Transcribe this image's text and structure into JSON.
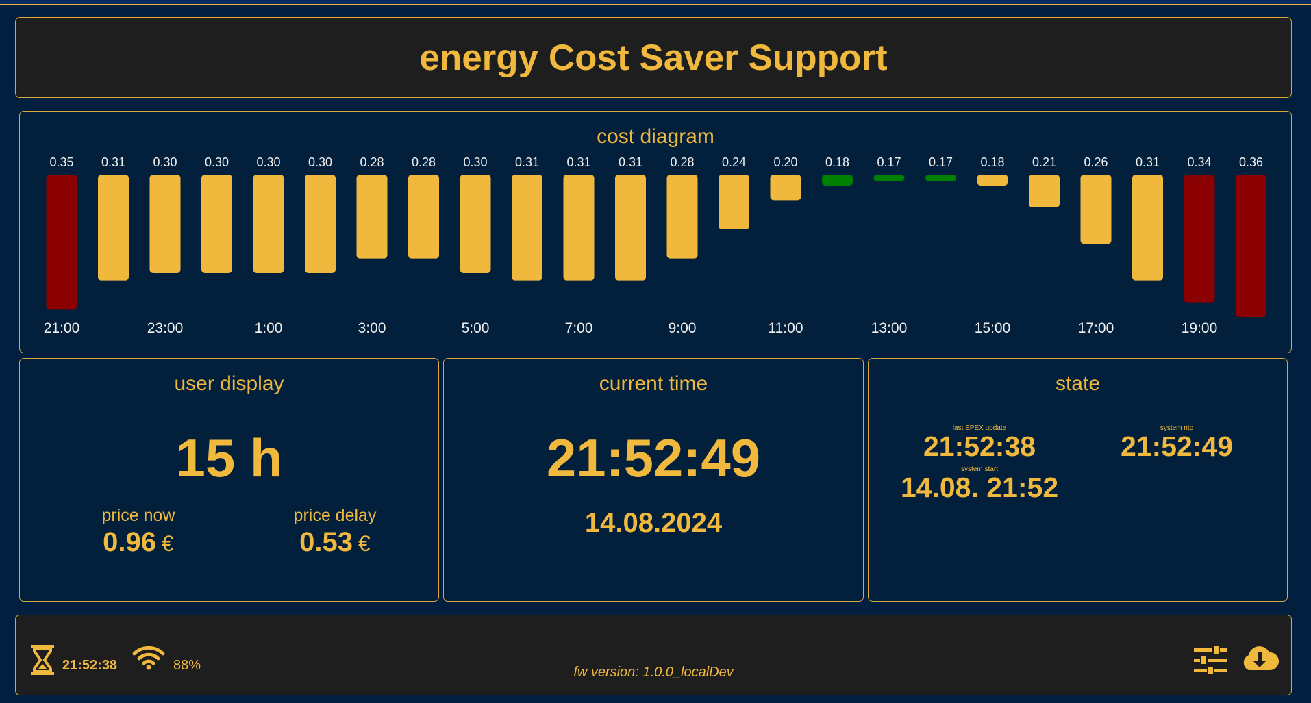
{
  "header": {
    "title": "energy Cost Saver Support"
  },
  "cost_diagram": {
    "title": "cost diagram"
  },
  "chart_data": {
    "type": "bar",
    "title": "cost diagram",
    "values": [
      0.35,
      0.31,
      0.3,
      0.3,
      0.3,
      0.3,
      0.28,
      0.28,
      0.3,
      0.31,
      0.31,
      0.31,
      0.28,
      0.24,
      0.2,
      0.18,
      0.17,
      0.17,
      0.18,
      0.21,
      0.26,
      0.31,
      0.34,
      0.36
    ],
    "value_labels": [
      "0.35",
      "0.31",
      "0.30",
      "0.30",
      "0.30",
      "0.30",
      "0.28",
      "0.28",
      "0.30",
      "0.31",
      "0.31",
      "0.31",
      "0.28",
      "0.24",
      "0.20",
      "0.18",
      "0.17",
      "0.17",
      "0.18",
      "0.21",
      "0.26",
      "0.31",
      "0.34",
      "0.36"
    ],
    "bar_status": [
      "high",
      "mid",
      "mid",
      "mid",
      "mid",
      "mid",
      "mid",
      "mid",
      "mid",
      "mid",
      "mid",
      "mid",
      "mid",
      "mid",
      "mid",
      "low",
      "low",
      "low",
      "mid",
      "mid",
      "mid",
      "mid",
      "high",
      "high"
    ],
    "x_tick_labels": [
      "21:00",
      "23:00",
      "1:00",
      "3:00",
      "5:00",
      "7:00",
      "9:00",
      "11:00",
      "13:00",
      "15:00",
      "17:00",
      "19:00"
    ],
    "ylim": [
      0.165,
      0.36
    ],
    "colors": {
      "high": "#8b0000",
      "mid": "#f0b93e",
      "low": "#008000"
    },
    "grid": false
  },
  "user_display": {
    "title": "user display",
    "hours": "15 h",
    "price_now_label": "price now",
    "price_now_value": "0.96",
    "price_delay_label": "price delay",
    "price_delay_value": "0.53",
    "currency": "€"
  },
  "current_time": {
    "title": "current time",
    "time": "21:52:49",
    "date": "14.08.2024"
  },
  "state": {
    "title": "state",
    "last_epex_label": "last EPEX update",
    "last_epex_value": "21:52:38",
    "system_ntp_label": "system ntp",
    "system_ntp_value": "21:52:49",
    "system_start_label": "system start",
    "system_start_value": "14.08. 21:52"
  },
  "footer": {
    "timer_icon": "hourglass-icon",
    "timer_value": "21:52:38",
    "wifi_icon": "wifi-icon",
    "wifi_strength": "88%",
    "fw_version": "fw version: 1.0.0_localDev",
    "settings_icon": "sliders-icon",
    "download_icon": "cloud-download-icon"
  }
}
